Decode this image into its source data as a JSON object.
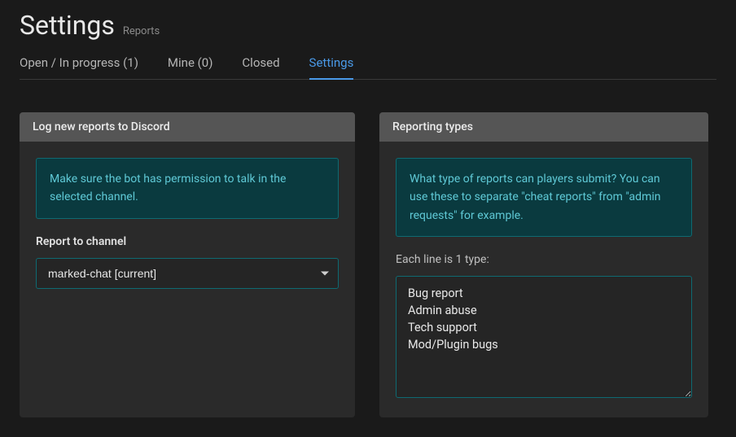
{
  "header": {
    "title": "Settings",
    "breadcrumb": "Reports"
  },
  "tabs": [
    {
      "label": "Open / In progress (1)",
      "active": false
    },
    {
      "label": "Mine (0)",
      "active": false
    },
    {
      "label": "Closed",
      "active": false
    },
    {
      "label": "Settings",
      "active": true
    }
  ],
  "panel_discord": {
    "title": "Log new reports to Discord",
    "info": "Make sure the bot has permission to talk in the selected channel.",
    "field_label": "Report to channel",
    "selected_channel": "marked-chat [current]"
  },
  "panel_types": {
    "title": "Reporting types",
    "info": "What type of reports can players submit? You can use these to separate \"cheat reports\" from \"admin requests\" for example.",
    "sub_label": "Each line is 1 type:",
    "textarea_value": "Bug report\nAdmin abuse\nTech support\nMod/Plugin bugs"
  }
}
